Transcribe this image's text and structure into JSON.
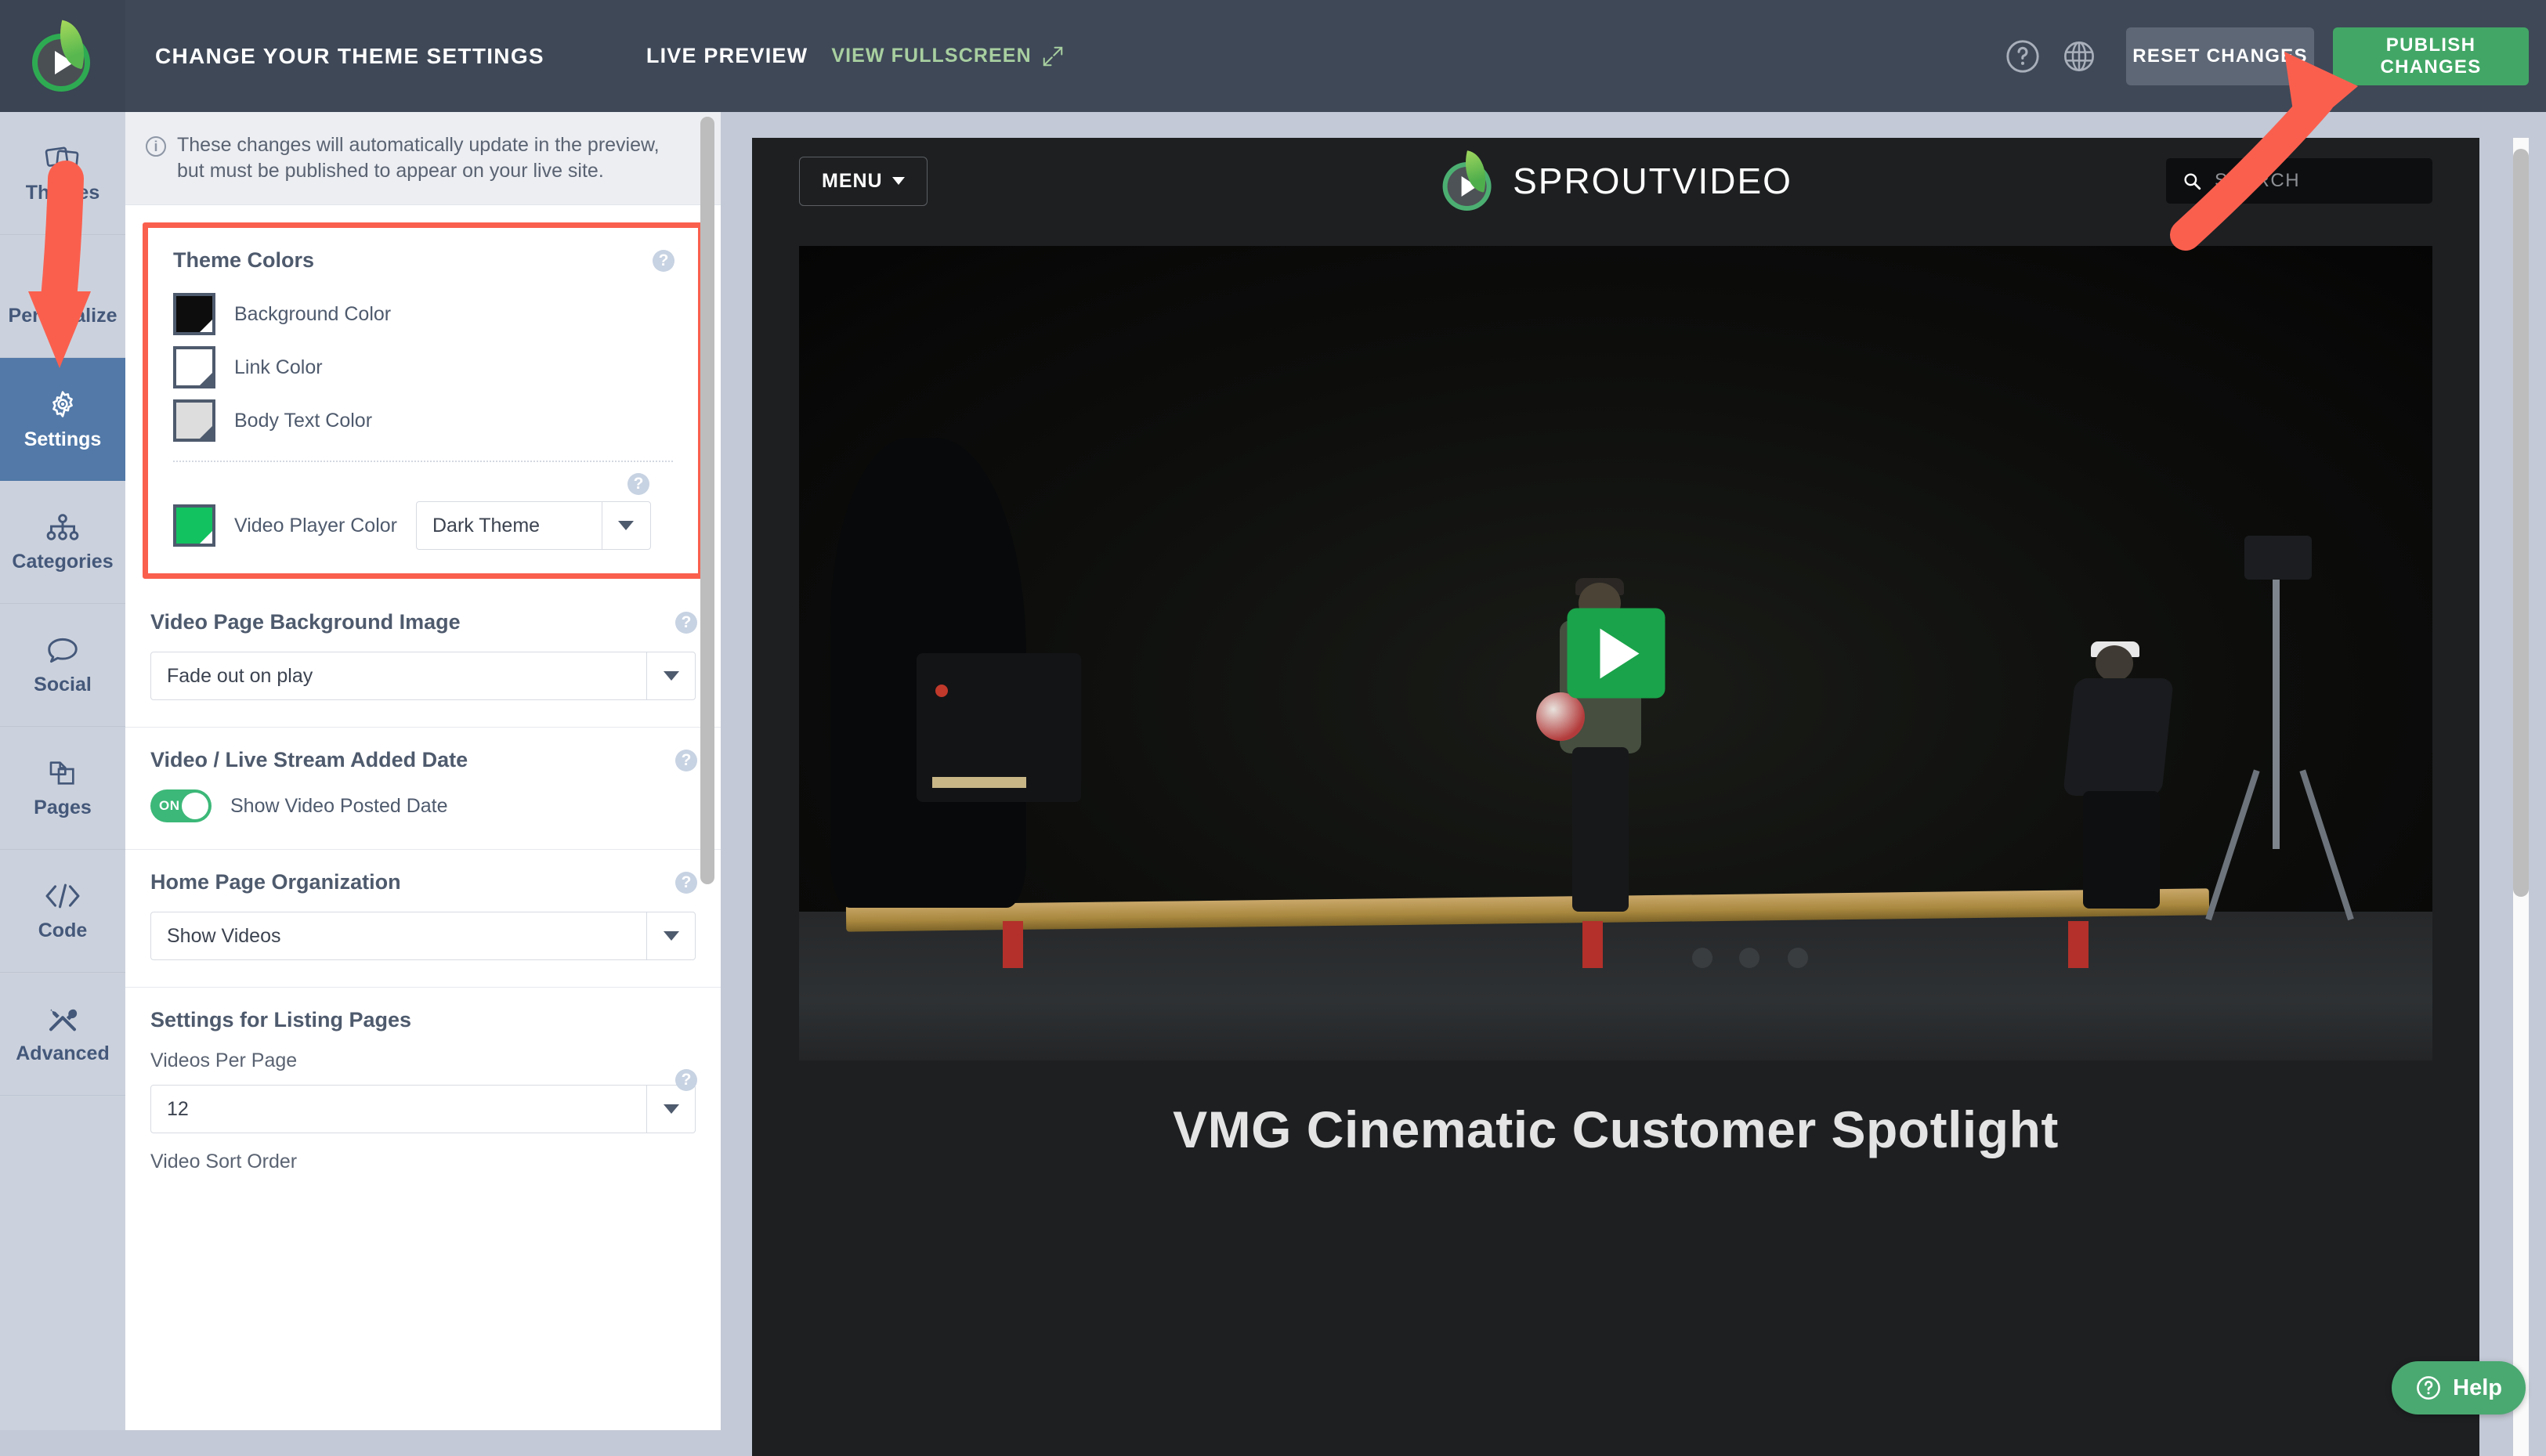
{
  "header": {
    "panel_title": "CHANGE YOUR THEME SETTINGS",
    "live_preview_label": "LIVE PREVIEW",
    "view_fullscreen_label": "VIEW FULLSCREEN",
    "reset_label": "RESET CHANGES",
    "publish_label": "PUBLISH CHANGES",
    "help_icon": "question-circle-icon",
    "globe_icon": "globe-icon",
    "logo_icon": "sproutvideo-logo-icon"
  },
  "sidebar": {
    "items": [
      {
        "label": "Themes",
        "icon": "themes-icon",
        "active": false
      },
      {
        "label": "Personalize",
        "icon": "pencil-icon",
        "active": false
      },
      {
        "label": "Settings",
        "icon": "gear-icon",
        "active": true
      },
      {
        "label": "Categories",
        "icon": "sitemap-icon",
        "active": false
      },
      {
        "label": "Social",
        "icon": "speech-bubble-icon",
        "active": false
      },
      {
        "label": "Pages",
        "icon": "pages-icon",
        "active": false
      },
      {
        "label": "Code",
        "icon": "code-brackets-icon",
        "active": false
      },
      {
        "label": "Advanced",
        "icon": "tools-icon",
        "active": false
      }
    ]
  },
  "settings": {
    "notice": "These changes will automatically update in the preview, but must be published to appear on your live site.",
    "theme_colors": {
      "title": "Theme Colors",
      "help": "?",
      "swatches": [
        {
          "label": "Background Color",
          "color": "#0d0d0d"
        },
        {
          "label": "Link Color",
          "color": "#ffffff"
        },
        {
          "label": "Body Text Color",
          "color": "#dddddd"
        }
      ],
      "player": {
        "label": "Video Player Color",
        "color": "#12c261",
        "value": "Dark Theme",
        "help": "?"
      }
    },
    "video_page_background": {
      "title": "Video Page Background Image",
      "value": "Fade out on play",
      "help": "?"
    },
    "added_date": {
      "title": "Video / Live Stream Added Date",
      "toggle_state": "ON",
      "toggle_label": "Show Video Posted Date",
      "help": "?"
    },
    "home_page_organization": {
      "title": "Home Page Organization",
      "value": "Show Videos",
      "help": "?"
    },
    "listing_pages": {
      "title": "Settings for Listing Pages",
      "videos_per_page_label": "Videos Per Page",
      "videos_per_page_value": "12",
      "help": "?",
      "sort_order_label": "Video Sort Order"
    }
  },
  "preview": {
    "menu_label": "MENU",
    "site_name": "SPROUTVIDEO",
    "search_placeholder": "SEARCH",
    "search_icon": "search-icon",
    "play_icon": "play-icon",
    "video_title": "VMG Cinematic Customer Spotlight"
  },
  "help_widget": {
    "label": "Help",
    "icon": "question-circle-icon"
  },
  "colors": {
    "topbar": "#3e4857",
    "accent_green": "#42a766",
    "annotation_red": "#fa5f4e",
    "nav_active": "#5279a8"
  }
}
